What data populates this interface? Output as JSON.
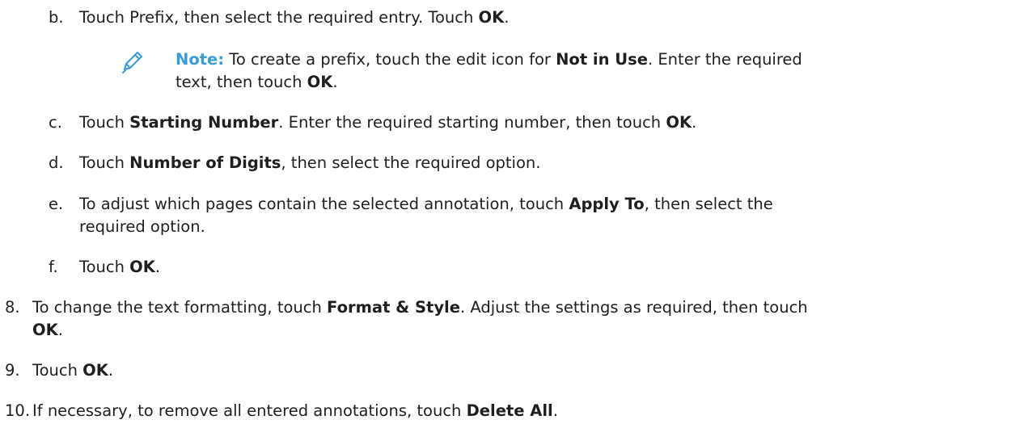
{
  "items": {
    "b": {
      "marker": "b.",
      "t1": "Touch Prefix, then select the required entry. Touch ",
      "b1": "OK",
      "t2": "."
    },
    "note": {
      "icon": "pencil-icon",
      "label": "Note:",
      "t1": " To create a prefix, touch the edit icon for ",
      "b1": "Not in Use",
      "t2": ". Enter the required",
      "t3": "text, then touch ",
      "b2": "OK",
      "t4": "."
    },
    "c": {
      "marker": "c.",
      "t1": "Touch ",
      "b1": "Starting Number",
      "t2": ". Enter the required starting number, then touch ",
      "b2": "OK",
      "t3": "."
    },
    "d": {
      "marker": "d.",
      "t1": "Touch ",
      "b1": "Number of Digits",
      "t2": ", then select the required option."
    },
    "e": {
      "marker": "e.",
      "t1": "To adjust which pages contain the selected annotation, touch ",
      "b1": "Apply To",
      "t2": ", then select the",
      "t3": "required option."
    },
    "f": {
      "marker": "f.",
      "t1": "Touch ",
      "b1": "OK",
      "t2": "."
    },
    "s8": {
      "marker": "8.",
      "t1": "To change the text formatting, touch ",
      "b1": "Format & Style",
      "t2": ". Adjust the settings as required, then touch",
      "b2": "OK",
      "t3": "."
    },
    "s9": {
      "marker": "9.",
      "t1": "Touch ",
      "b1": "OK",
      "t2": "."
    },
    "s10": {
      "marker": "10.",
      "t1": "If necessary, to remove all entered annotations, touch ",
      "b1": "Delete All",
      "t2": "."
    }
  },
  "colors": {
    "note_accent": "#3a9bd5",
    "text": "#1f1f1f"
  }
}
